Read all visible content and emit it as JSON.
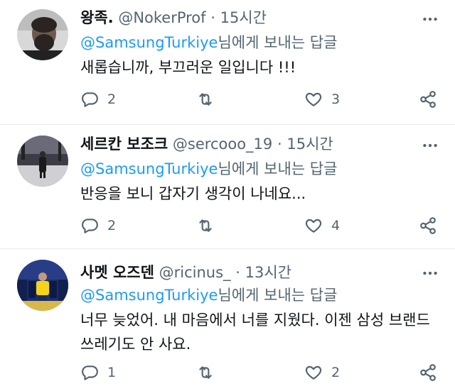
{
  "tweets": [
    {
      "name": "왕족.",
      "handle": "@NokerProf",
      "dot": "·",
      "time": "15시간",
      "reply_prefix": "@SamsungTurkiye",
      "reply_suffix": "님에게 보내는 답글",
      "text": "새롭습니까, 부끄러운 일입니다 !!!",
      "reply_count": "2",
      "retweet_count": "",
      "like_count": "3"
    },
    {
      "name": "세르칸 보조크",
      "handle": "@sercooo_19",
      "dot": "·",
      "time": "15시간",
      "reply_prefix": "@SamsungTurkiye",
      "reply_suffix": "님에게 보내는 답글",
      "text": "반응을 보니 갑자기 생각이 나네요...",
      "reply_count": "2",
      "retweet_count": "",
      "like_count": "4"
    },
    {
      "name": "사멧 오즈덴",
      "handle": "@ricinus_",
      "dot": "·",
      "time": "13시간",
      "reply_prefix": "@SamsungTurkiye",
      "reply_suffix": "님에게 보내는 답글",
      "text": "너무 늦었어. 내 마음에서 너를 지웠다. 이젠 삼성 브랜드 쓰레기도 안 사요.",
      "reply_count": "1",
      "retweet_count": "",
      "like_count": "2"
    }
  ],
  "colors": {
    "text": "#0f1419",
    "secondary": "#536471",
    "link": "#1d9bf0",
    "divider": "#e6ecf0"
  },
  "icons": [
    "more-icon",
    "reply-icon",
    "retweet-icon",
    "like-icon",
    "share-icon"
  ]
}
